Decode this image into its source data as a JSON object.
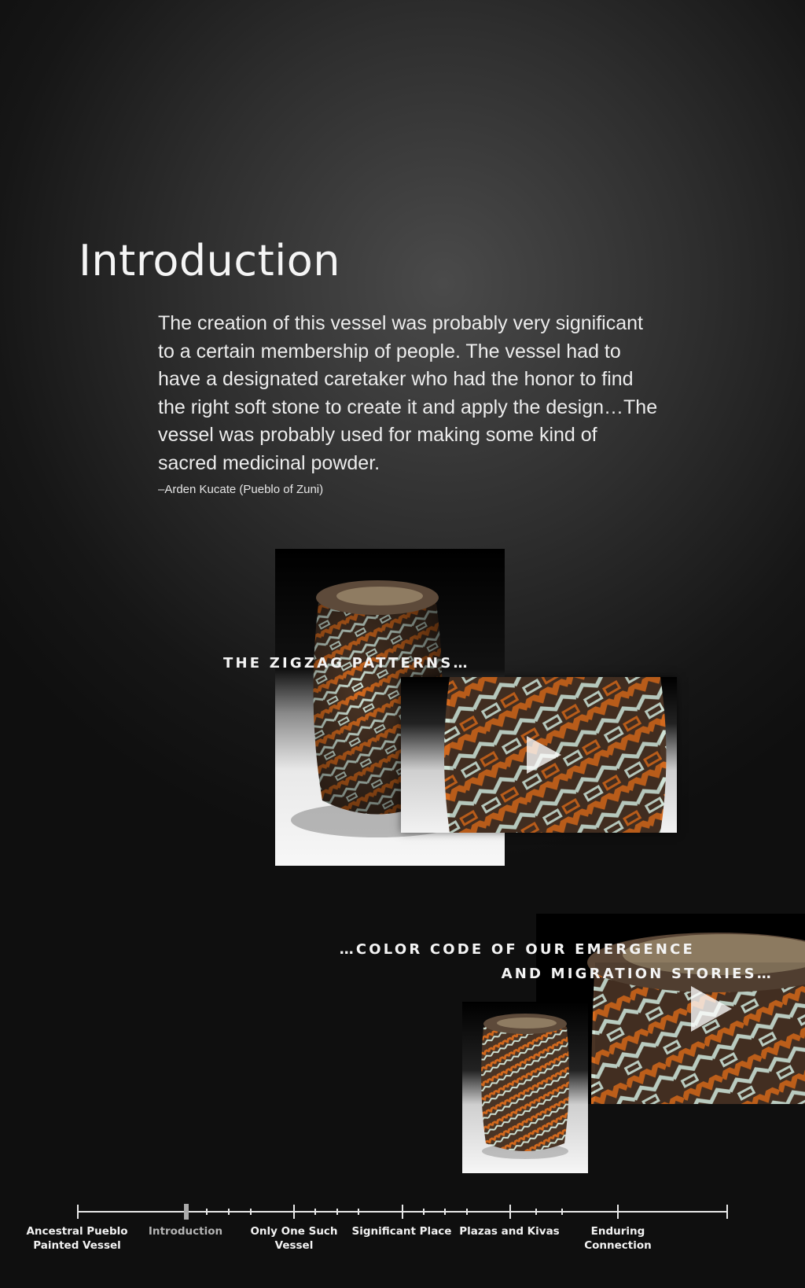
{
  "page": {
    "title": "Introduction",
    "quote": "The creation of this vessel was probably very significant to a certain membership of people. The vessel had to have a designated caretaker who had the honor to find the right soft stone to create it and apply the design…The vessel was probably used for making some kind of sacred medicinal powder.",
    "attribution": "–Arden Kucate (Pueblo of Zuni)"
  },
  "videos": [
    {
      "caption": "the zigzag patterns…",
      "thumbnail": "vessel-full-photo",
      "preview": "vessel-zigzag-closeup",
      "icon": "play-icon"
    },
    {
      "caption_line1": "…color code of our emergence",
      "caption_line2": "and migration stories…",
      "thumbnail": "vessel-small-photo",
      "preview": "vessel-rim-closeup",
      "icon": "play-icon"
    }
  ],
  "timeline": {
    "sections": [
      {
        "label": "Ancestral Pueblo Painted Vessel",
        "line1": "Ancestral Pueblo",
        "line2": "Painted Vessel",
        "current": false
      },
      {
        "label": "Introduction",
        "line1": "Introduction",
        "line2": "",
        "current": true
      },
      {
        "label": "Only One Such Vessel",
        "line1": "Only One Such",
        "line2": "Vessel",
        "current": false
      },
      {
        "label": "Significant Place",
        "line1": "Significant Place",
        "line2": "",
        "current": false
      },
      {
        "label": "Plazas and Kivas",
        "line1": "Plazas and Kivas",
        "line2": "",
        "current": false
      },
      {
        "label": "Enduring Connection",
        "line1": "Enduring",
        "line2": "Connection",
        "current": false
      }
    ]
  },
  "colors": {
    "accent_orange": "#d2691e",
    "pattern_white": "#cfe3d6",
    "stone_brown": "#4a3425",
    "background": "#1a1a1a"
  }
}
